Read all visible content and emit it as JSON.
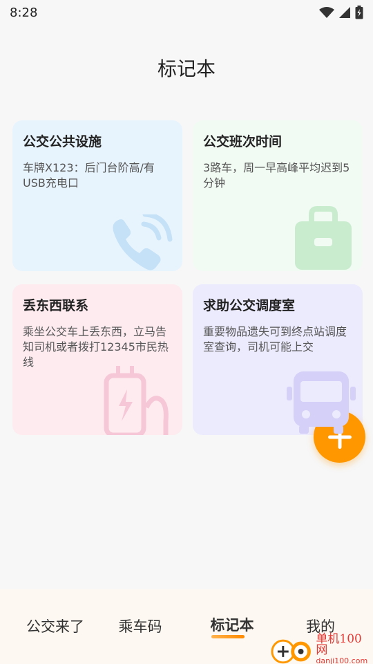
{
  "status_bar": {
    "time": "8:28"
  },
  "header": {
    "title": "标记本"
  },
  "cards": [
    {
      "title": "公交公共设施",
      "body": "车牌X123：后门台阶高/有USB充电口",
      "icon": "phone-icon",
      "color": "#e8f4fd"
    },
    {
      "title": "公交班次时间",
      "body": "3路车，周一早高峰平均迟到5分钟",
      "icon": "briefcase-icon",
      "color": "#f1faf3"
    },
    {
      "title": "丢东西联系",
      "body": "乘坐公交车上丢东西，立马告知司机或者拨打12345市民热线",
      "icon": "charger-icon",
      "color": "#fdebf0"
    },
    {
      "title": "求助公交调度室",
      "body": "重要物品遗失可到终点站调度室查询，司机可能上交",
      "icon": "bus-icon",
      "color": "#ecebfd"
    }
  ],
  "fab": {
    "icon": "plus-icon"
  },
  "bottom_nav": {
    "items": [
      {
        "label": "公交来了"
      },
      {
        "label": "乘车码"
      },
      {
        "label": "标记本",
        "active": true
      },
      {
        "label": "我的"
      }
    ]
  },
  "watermark": {
    "main": "单机100网",
    "sub": "danji100.com"
  }
}
